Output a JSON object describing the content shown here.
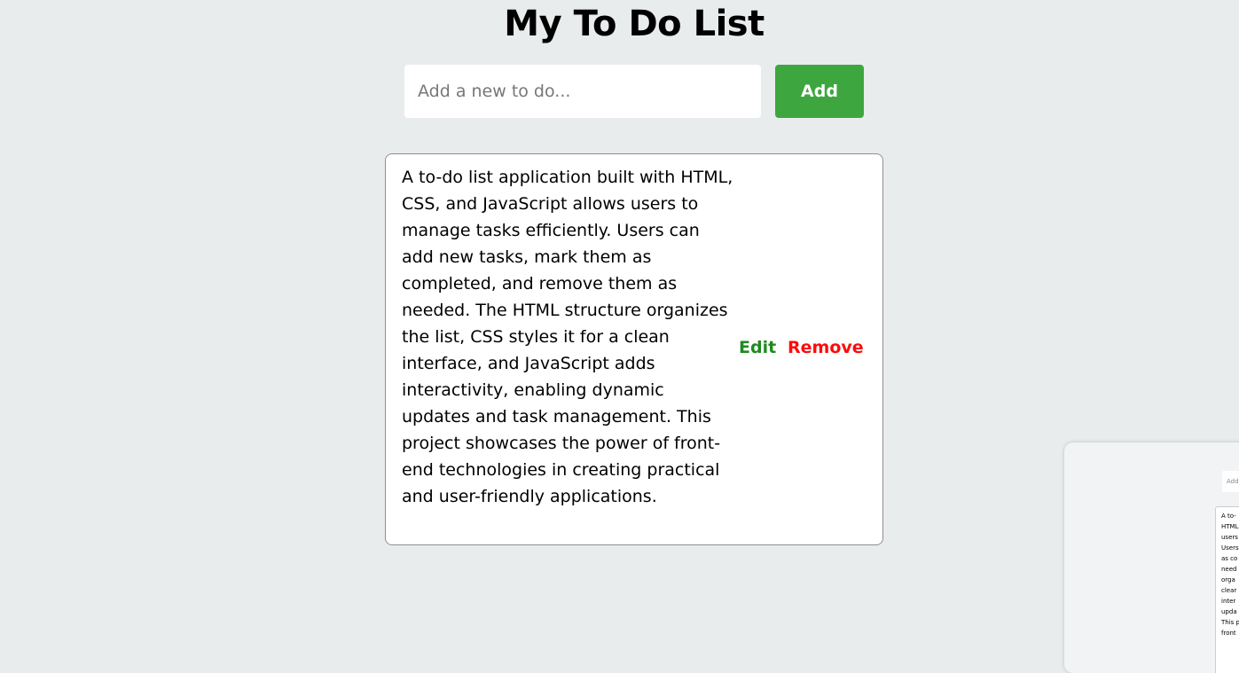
{
  "header": {
    "title": "My To Do List"
  },
  "add_form": {
    "input_value": "",
    "placeholder": "Add a new to do...",
    "add_label": "Add"
  },
  "todos": [
    {
      "text": "A to-do list application built with HTML, CSS, and JavaScript allows users to manage tasks efficiently. Users can add new tasks, mark them as completed, and remove them as needed. The HTML structure organizes the list, CSS styles it for a clean interface, and JavaScript adds interactivity, enabling dynamic updates and task management. This project showcases the power of front-end technologies in creating practical and user-friendly applications.",
      "edit_label": "Edit",
      "remove_label": "Remove"
    }
  ],
  "mini_preview": {
    "input_text": "Add",
    "card_text": "A to-\nHTML\nusers\nUsers\nas co\nneed\norga\nclear\ninter\nupda\nThis p\nfront"
  },
  "colors": {
    "background": "#e8eced",
    "add_button": "#3ea63f",
    "edit": "#1f8a1f",
    "remove": "#ff0a0a"
  }
}
